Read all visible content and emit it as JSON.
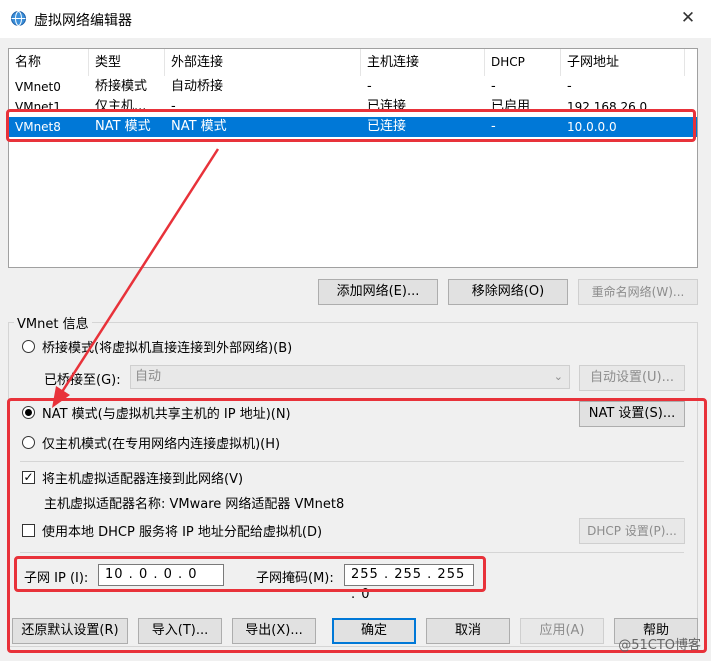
{
  "window": {
    "title": "虚拟网络编辑器",
    "close_glyph": "✕",
    "icon": "network-globe-icon"
  },
  "table": {
    "columns": [
      "名称",
      "类型",
      "外部连接",
      "主机连接",
      "DHCP",
      "子网地址"
    ],
    "rows": [
      {
        "name": "VMnet0",
        "type": "桥接模式",
        "external": "自动桥接",
        "host": "-",
        "dhcp": "-",
        "subnet": "-"
      },
      {
        "name": "VMnet1",
        "type": "仅主机...",
        "external": "-",
        "host": "已连接",
        "dhcp": "已启用",
        "subnet": "192.168.26.0"
      },
      {
        "name": "VMnet8",
        "type": "NAT 模式",
        "external": "NAT 模式",
        "host": "已连接",
        "dhcp": "-",
        "subnet": "10.0.0.0"
      }
    ],
    "selected_row": 2
  },
  "table_buttons": {
    "add": "添加网络(E)...",
    "remove": "移除网络(O)",
    "rename": "重命名网络(W)..."
  },
  "info": {
    "legend": "VMnet 信息",
    "bridge_radio": "桥接模式(将虚拟机直接连接到外部网络)(B)",
    "bridged_to_label": "已桥接至(G):",
    "bridged_to_value": "自动",
    "auto_settings": "自动设置(U)...",
    "nat_radio": "NAT 模式(与虚拟机共享主机的 IP 地址)(N)",
    "nat_settings": "NAT 设置(S)...",
    "hostonly_radio": "仅主机模式(在专用网络内连接虚拟机)(H)",
    "connect_adapter_check": "将主机虚拟适配器连接到此网络(V)",
    "adapter_name": "主机虚拟适配器名称: VMware 网络适配器 VMnet8",
    "dhcp_check": "使用本地 DHCP 服务将 IP 地址分配给虚拟机(D)",
    "dhcp_settings": "DHCP 设置(P)...",
    "subnet_ip_label": "子网 IP (I):",
    "subnet_ip_value": "10 . 0 . 0 . 0",
    "subnet_mask_label": "子网掩码(M):",
    "subnet_mask_value": "255 . 255 . 255 . 0",
    "selected_mode": "nat",
    "connect_adapter_checked": true,
    "dhcp_checked": false
  },
  "bottom_buttons": {
    "restore": "还原默认设置(R)",
    "import": "导入(T)...",
    "export": "导出(X)...",
    "ok": "确定",
    "cancel": "取消",
    "apply": "应用(A)",
    "help": "帮助"
  },
  "watermark": "@51CTO博客",
  "colors": {
    "selection": "#0078d7",
    "annotation_red": "#e8323a"
  }
}
